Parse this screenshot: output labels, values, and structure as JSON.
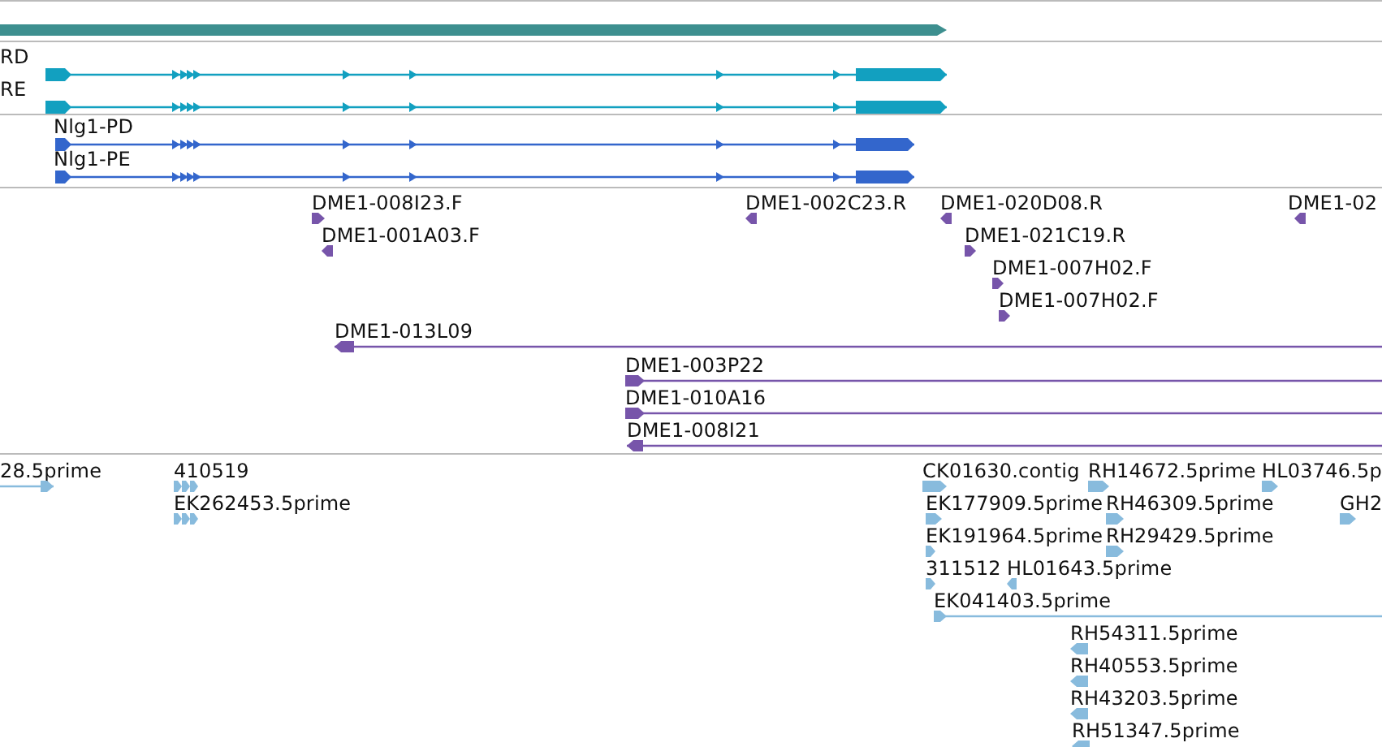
{
  "tracks": [
    {
      "kind": "bar",
      "color": "#3d8f8f"
    },
    {
      "kind": "gene_models",
      "color": "#12a0c0",
      "features": [
        {
          "label": "RD",
          "reverse": false
        },
        {
          "label": "RE",
          "reverse": false
        }
      ]
    },
    {
      "kind": "gene_models",
      "color": "#3366cc",
      "features": [
        {
          "label": "Nlg1-PD",
          "reverse": false
        },
        {
          "label": "Nlg1-PE",
          "reverse": false
        }
      ]
    },
    {
      "kind": "features",
      "color": "#7755aa",
      "features": [
        {
          "label": "DME1-008I23.F",
          "kind": "short",
          "reverse": false
        },
        {
          "label": "DME1-001A03.F",
          "kind": "short",
          "reverse": true
        },
        {
          "label": "DME1-002C23.R",
          "kind": "short",
          "reverse": true
        },
        {
          "label": "DME1-020D08.R",
          "kind": "short",
          "reverse": true
        },
        {
          "label": "DME1-021C19.R",
          "kind": "short",
          "reverse": false
        },
        {
          "label": "DME1-007H02.F",
          "kind": "short",
          "reverse": false
        },
        {
          "label": "DME1-007H02.F",
          "kind": "short",
          "reverse": false
        },
        {
          "label": "DME1-02",
          "kind": "short",
          "reverse": true
        },
        {
          "label": "DME1-013L09",
          "kind": "long",
          "reverse": true
        },
        {
          "label": "DME1-003P22",
          "kind": "long",
          "reverse": false
        },
        {
          "label": "DME1-010A16",
          "kind": "long",
          "reverse": false
        },
        {
          "label": "DME1-008I21",
          "kind": "long",
          "reverse": true
        }
      ]
    },
    {
      "kind": "features",
      "color": "#88bbdd",
      "features": [
        {
          "label": "28.5prime",
          "kind": "long",
          "reverse": false
        },
        {
          "label": "410519",
          "kind": "triple",
          "reverse": false
        },
        {
          "label": "EK262453.5prime",
          "kind": "triple",
          "reverse": false
        },
        {
          "label": "CK01630.contig",
          "kind": "short",
          "reverse": false
        },
        {
          "label": "RH14672.5prime",
          "kind": "short",
          "reverse": false
        },
        {
          "label": "HL03746.5p",
          "kind": "short",
          "reverse": false
        },
        {
          "label": "EK177909.5prime",
          "kind": "short",
          "reverse": false
        },
        {
          "label": "RH46309.5prime",
          "kind": "short",
          "reverse": false
        },
        {
          "label": "GH2",
          "kind": "short",
          "reverse": false
        },
        {
          "label": "EK191964.5prime",
          "kind": "short",
          "reverse": false
        },
        {
          "label": "RH29429.5prime",
          "kind": "short",
          "reverse": false
        },
        {
          "label": "311512",
          "kind": "short",
          "reverse": false
        },
        {
          "label": "HL01643.5prime",
          "kind": "short",
          "reverse": true
        },
        {
          "label": "EK041403.5prime",
          "kind": "long",
          "reverse": false
        },
        {
          "label": "RH54311.5prime",
          "kind": "short",
          "reverse": true
        },
        {
          "label": "RH40553.5prime",
          "kind": "short",
          "reverse": true
        },
        {
          "label": "RH43203.5prime",
          "kind": "short",
          "reverse": true
        },
        {
          "label": "RH51347.5prime",
          "kind": "short",
          "reverse": true
        }
      ]
    }
  ]
}
